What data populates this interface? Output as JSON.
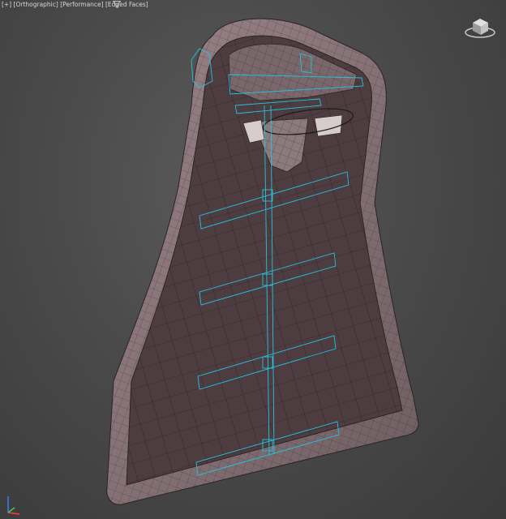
{
  "viewport": {
    "label_plus": "[+]",
    "label_view": "[Orthographic]",
    "label_shading": "[Performance]",
    "label_faces": "[Edged Faces]",
    "filter_icon": "funnel-icon",
    "viewcube_icon": "viewcube-icon",
    "axis_icon": "axis-tripod-icon"
  },
  "colors": {
    "mesh_fill": "#6b5a5e",
    "mesh_wire": "#1e1a1b",
    "wire_cyan": "#22c4e0",
    "background": "#4a4a4a"
  }
}
